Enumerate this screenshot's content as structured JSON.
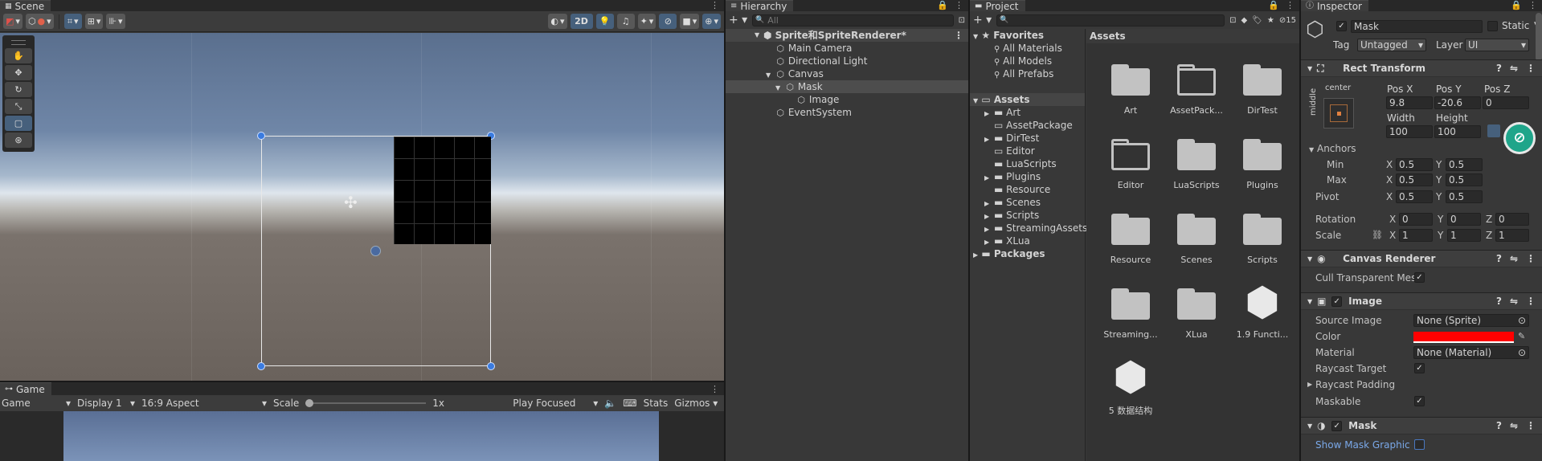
{
  "scene": {
    "tab": "Scene",
    "mode_2d": "2D"
  },
  "game": {
    "tab": "Game",
    "view": "Game",
    "display": "Display 1",
    "aspect": "16:9 Aspect",
    "scale_label": "Scale",
    "scale_value": "1x",
    "play_mode": "Play Focused",
    "stats": "Stats",
    "gizmos": "Gizmos"
  },
  "hierarchy": {
    "tab": "Hierarchy",
    "search_placeholder": "All",
    "items": [
      {
        "label": "Sprite和SpriteRenderer*"
      },
      {
        "label": "Main Camera"
      },
      {
        "label": "Directional Light"
      },
      {
        "label": "Canvas"
      },
      {
        "label": "Mask"
      },
      {
        "label": "Image"
      },
      {
        "label": "EventSystem"
      }
    ]
  },
  "project": {
    "tab": "Project",
    "count": "15",
    "favorites": {
      "label": "Favorites",
      "items": [
        "All Materials",
        "All Models",
        "All Prefabs"
      ]
    },
    "assets_label": "Assets",
    "packages_label": "Packages",
    "tree": [
      "Art",
      "AssetPackage",
      "DirTest",
      "Editor",
      "LuaScripts",
      "Plugins",
      "Resource",
      "Scenes",
      "Scripts",
      "StreamingAssets",
      "XLua"
    ],
    "breadcrumb": "Assets",
    "grid": [
      "Art",
      "AssetPack...",
      "DirTest",
      "Editor",
      "LuaScripts",
      "Plugins",
      "Resource",
      "Scenes",
      "Scripts",
      "Streaming...",
      "XLua",
      "1.9 Functi...",
      "5 数据结构"
    ]
  },
  "inspector": {
    "tab": "Inspector",
    "object_name": "Mask",
    "static_label": "Static",
    "tag_label": "Tag",
    "tag_value": "Untagged",
    "layer_label": "Layer",
    "layer_value": "UI",
    "rect": {
      "title": "Rect Transform",
      "anchor_h": "center",
      "anchor_v": "middle",
      "posx_label": "Pos X",
      "posy_label": "Pos Y",
      "posz_label": "Pos Z",
      "posx": "9.8",
      "posy": "-20.6",
      "posz": "0",
      "width_label": "Width",
      "height_label": "Height",
      "width": "100",
      "height": "100",
      "anchors_label": "Anchors",
      "min_label": "Min",
      "max_label": "Max",
      "pivot_label": "Pivot",
      "rotation_label": "Rotation",
      "scale_label": "Scale",
      "x": "X",
      "y": "Y",
      "z": "Z",
      "min_x": "0.5",
      "min_y": "0.5",
      "max_x": "0.5",
      "max_y": "0.5",
      "pivot_x": "0.5",
      "pivot_y": "0.5",
      "rot_x": "0",
      "rot_y": "0",
      "rot_z": "0",
      "scale_x": "1",
      "scale_y": "1",
      "scale_z": "1"
    },
    "canvas_renderer": {
      "title": "Canvas Renderer",
      "cull_label": "Cull Transparent Mes"
    },
    "image": {
      "title": "Image",
      "source_label": "Source Image",
      "source_value": "None (Sprite)",
      "color_label": "Color",
      "color_value": "#ff0000",
      "material_label": "Material",
      "material_value": "None (Material)",
      "raycast_label": "Raycast Target",
      "padding_label": "Raycast Padding",
      "maskable_label": "Maskable"
    },
    "mask": {
      "title": "Mask",
      "show_graphic_label": "Show Mask Graphic"
    }
  }
}
